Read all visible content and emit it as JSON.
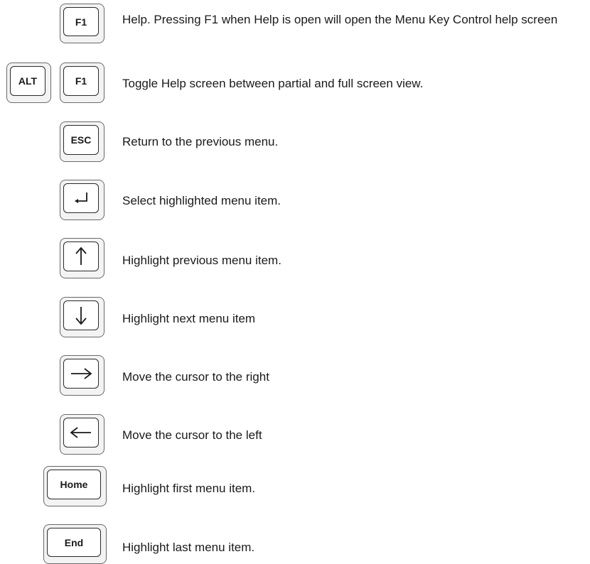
{
  "keys": {
    "f1": "F1",
    "alt": "ALT",
    "esc": "ESC",
    "home": "Home",
    "end": "End"
  },
  "icons": {
    "enter": "enter-icon",
    "up": "arrow-up-icon",
    "down": "arrow-down-icon",
    "right": "arrow-right-icon",
    "left": "arrow-left-icon"
  },
  "descriptions": {
    "f1_help": "Help. Pressing F1 when Help is open will open the Menu Key Control help screen",
    "alt_f1": "Toggle Help screen between partial and full screen view.",
    "esc": "Return to the previous menu.",
    "enter": "Select highlighted menu item.",
    "up": "Highlight previous menu item.",
    "down": "Highlight next menu item",
    "right": "Move the cursor to the right",
    "left": "Move the cursor to the left",
    "home": "Highlight first menu item.",
    "end": "Highlight last menu item."
  }
}
